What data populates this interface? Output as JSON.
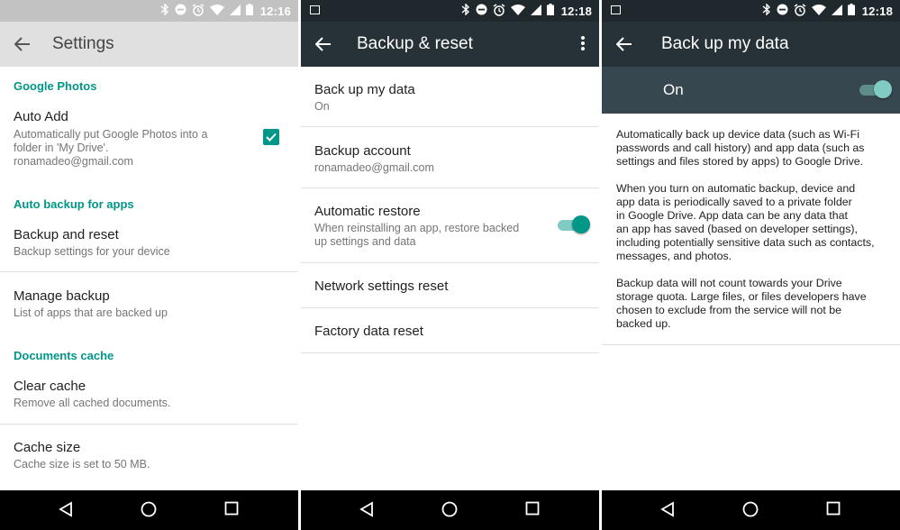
{
  "screen1": {
    "status_time": "12:16",
    "title": "Settings",
    "categories": {
      "photos": "Google Photos",
      "backup": "Auto backup for apps",
      "docs": "Documents cache"
    },
    "auto_add": {
      "title": "Auto Add",
      "summary_line1": "Automatically put Google Photos into a",
      "summary_line2": "folder in 'My Drive'.",
      "summary_line3": "ronamadeo@gmail.com",
      "checked": true
    },
    "backup_reset": {
      "title": "Backup and reset",
      "summary": "Backup settings for your device"
    },
    "manage_backup": {
      "title": "Manage backup",
      "summary": "List of apps that are backed up"
    },
    "clear_cache": {
      "title": "Clear cache",
      "summary": "Remove all cached documents."
    },
    "cache_size": {
      "title": "Cache size",
      "summary": "Cache size is set to 50 MB."
    }
  },
  "screen2": {
    "status_time": "12:18",
    "title": "Backup & reset",
    "back_up": {
      "title": "Back up my data",
      "summary": "On"
    },
    "account": {
      "title": "Backup account",
      "summary": "ronamadeo@gmail.com"
    },
    "auto_restore": {
      "title": "Automatic restore",
      "summary_line1": "When reinstalling an app, restore backed",
      "summary_line2": "up settings and data",
      "enabled": true
    },
    "network_reset": {
      "title": "Network settings reset"
    },
    "factory_reset": {
      "title": "Factory data reset"
    }
  },
  "screen3": {
    "status_time": "12:18",
    "title": "Back up my data",
    "switch_label": "On",
    "enabled": true,
    "para1": [
      "Automatically back up device data (such as Wi-Fi",
      "passwords and call history) and app data (such as",
      "settings and files stored by apps) to Google Drive."
    ],
    "para2": [
      "When you turn on automatic backup, device and",
      "app data is periodically saved to a private folder",
      "in Google Drive. App data can be any data that",
      "an app has saved (based on developer settings),",
      "including potentially sensitive data such as contacts,",
      "messages, and photos."
    ],
    "para3": [
      "Backup data will not count towards your Drive",
      "storage quota. Large files, or files developers have",
      "chosen to exclude from the service will not be",
      "backed up."
    ]
  },
  "icons": {
    "accent": "#009688",
    "status": [
      "bluetooth-icon",
      "do-not-disturb-icon",
      "alarm-icon",
      "wifi-icon",
      "signal-icon",
      "battery-icon"
    ],
    "nav": [
      "back-nav-icon",
      "home-nav-icon",
      "recents-nav-icon"
    ]
  }
}
